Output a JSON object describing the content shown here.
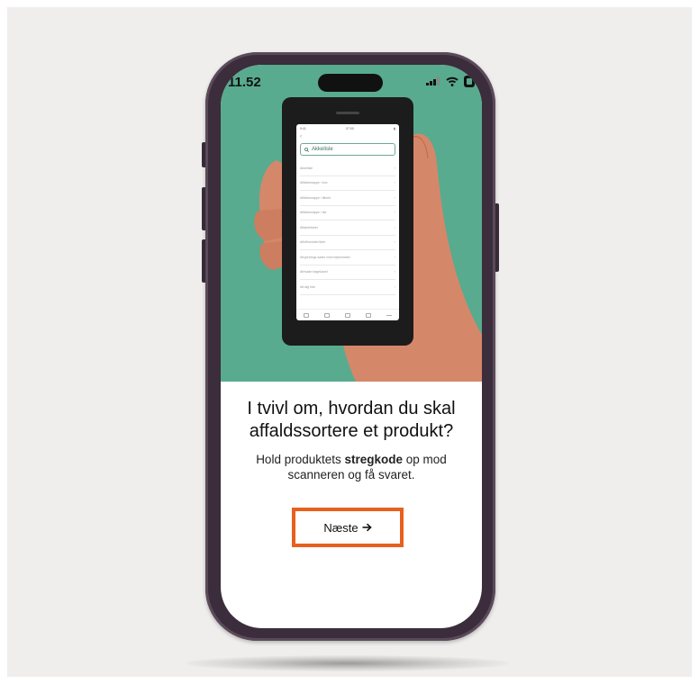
{
  "status_bar": {
    "time": "11.52"
  },
  "mini_app": {
    "status_time": "9:41",
    "status_center": "07:00",
    "search_text": "Akkelisle",
    "rows": [
      "Akkelisle",
      "Affaldsmappe i box",
      "Affaldsmappe i tilbehr",
      "Affaldsmappe i tsk",
      "Aftalebrikker",
      "Afluffsmiddel tider",
      "Afrgrenings sader med bejlemiddel",
      "Afrivade bagekavel",
      "Afrulig tide"
    ]
  },
  "onboarding": {
    "headline_line1": "I tvivl om, hvordan du skal",
    "headline_line2": "affaldssortere et produkt?",
    "subtext_prefix": "Hold produktets ",
    "subtext_bold": "stregkode",
    "subtext_suffix_line1": " op mod",
    "subtext_line2": "scanneren og få svaret.",
    "next_label": "Næste",
    "next_icon": "arrow-right-icon"
  },
  "colors": {
    "hero_green": "#58ab8f",
    "skin": "#d5876a",
    "highlight_orange": "#e8601d",
    "phone_frame": "#3b2d3b"
  }
}
